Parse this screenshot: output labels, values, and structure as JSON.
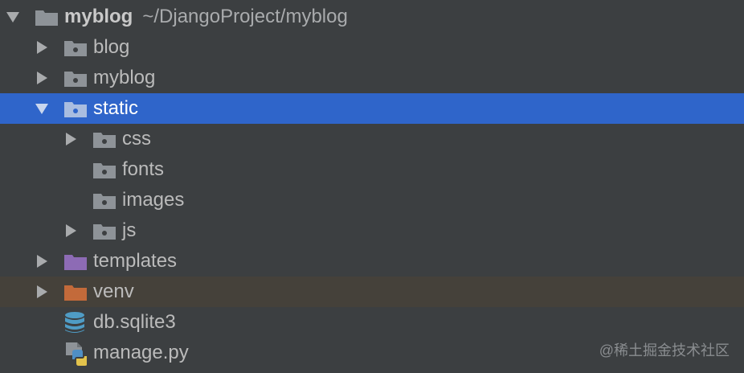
{
  "project_tree": {
    "root": {
      "name": "myblog",
      "path": "~/DjangoProject/myblog"
    },
    "items": [
      {
        "label": "blog"
      },
      {
        "label": "myblog"
      },
      {
        "label": "static"
      },
      {
        "label": "css"
      },
      {
        "label": "fonts"
      },
      {
        "label": "images"
      },
      {
        "label": "js"
      },
      {
        "label": "templates"
      },
      {
        "label": "venv"
      },
      {
        "label": "db.sqlite3"
      },
      {
        "label": "manage.py"
      }
    ]
  },
  "watermark": "@稀土掘金技术社区",
  "colors": {
    "background": "#3c3f41",
    "selection": "#2f65ca",
    "excluded_row": "#45413a",
    "folder": "#8e9398",
    "templates_folder": "#8d6bb5",
    "excluded_folder": "#c36a3a",
    "database": "#4f9cc5"
  }
}
